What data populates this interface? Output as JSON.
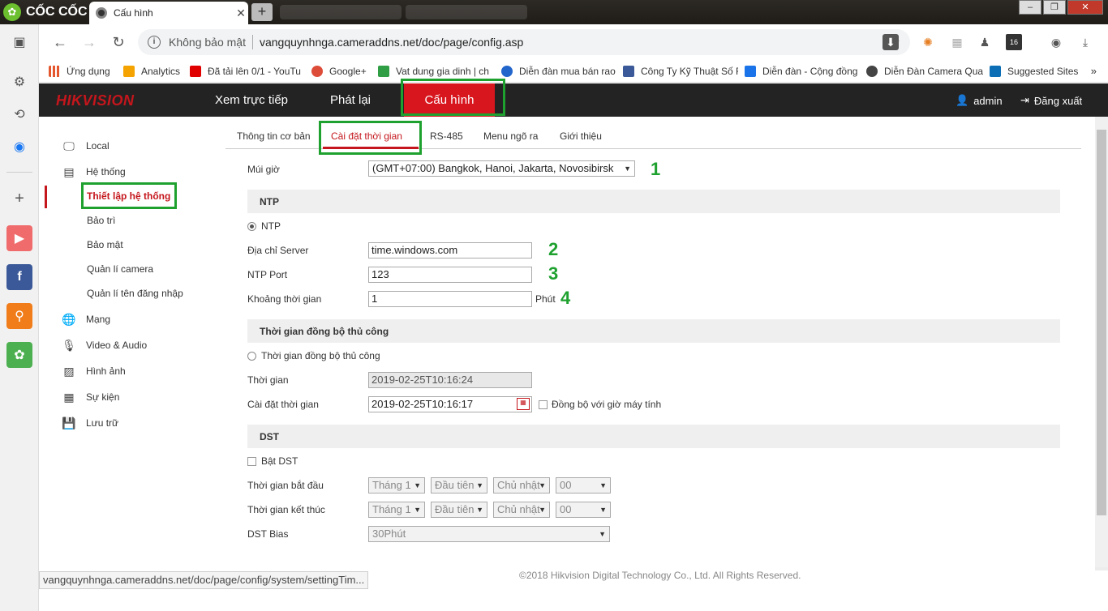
{
  "browser": {
    "brand": "CỐC CỐC",
    "tab_title": "Cấu hình",
    "security": "Không bảo mật",
    "url": "vangquynhnga.cameraddns.net/doc/page/config.asp",
    "status_url": "vangquynhnga.cameraddns.net/doc/page/config/system/settingTim..."
  },
  "bookmarks": [
    {
      "label": "Ứng dụng",
      "color": "#e4572e"
    },
    {
      "label": "Analytics",
      "color": "#f4a300"
    },
    {
      "label": "Đã tải lên 0/1 - YouTu",
      "color": "#e00000"
    },
    {
      "label": "Google+",
      "color": "#dd4b39"
    },
    {
      "label": "Vat dung gia dinh | ch",
      "color": "#2f9e44"
    },
    {
      "label": "Diễn đàn mua bán rao",
      "color": "#2266cc"
    },
    {
      "label": "Công Ty Kỹ Thuật Số F",
      "color": "#3b5998"
    },
    {
      "label": "Diễn đàn - Cộng đồng",
      "color": "#1a73e8"
    },
    {
      "label": "Diễn Đàn Camera Quan",
      "color": "#444444"
    },
    {
      "label": "Suggested Sites",
      "color": "#0c6eb5"
    }
  ],
  "app": {
    "logo": "HIKVISION",
    "nav": [
      "Xem trực tiếp",
      "Phát lại",
      "Cấu hình"
    ],
    "user": "admin",
    "logout": "Đăng xuất"
  },
  "sidebar": {
    "local": "Local",
    "system": "Hệ thống",
    "system_items": [
      "Thiết lập hệ thống",
      "Bảo trì",
      "Bảo mật",
      "Quản lí camera",
      "Quản lí tên đăng nhập"
    ],
    "network": "Mạng",
    "video_audio": "Video & Audio",
    "image": "Hình ảnh",
    "event": "Sự kiện",
    "storage": "Lưu trữ"
  },
  "tabs": [
    "Thông tin cơ bản",
    "Cài đặt thời gian",
    "RS-485",
    "Menu ngõ ra",
    "Giới thiệu"
  ],
  "form": {
    "timezone_label": "Múi giờ",
    "timezone_value": "(GMT+07:00) Bangkok, Hanoi, Jakarta, Novosibirsk",
    "ntp_section": "NTP",
    "ntp_radio": "NTP",
    "server_label": "Địa chỉ Server",
    "server_value": "time.windows.com",
    "port_label": "NTP Port",
    "port_value": "123",
    "interval_label": "Khoảng thời gian",
    "interval_value": "1",
    "interval_unit": "Phút",
    "manual_section": "Thời gian đồng bộ thủ công",
    "manual_radio": "Thời gian đồng bộ thủ công",
    "time_label": "Thời gian",
    "time_value": "2019-02-25T10:16:24",
    "settime_label": "Cài đặt thời gian",
    "settime_value": "2019-02-25T10:16:17",
    "sync_pc": "Đồng bộ với giờ máy tính",
    "dst_section": "DST",
    "dst_enable": "Bật DST",
    "start_label": "Thời gian bắt đầu",
    "end_label": "Thời gian kết thúc",
    "start_month": "Tháng 1",
    "start_week": "Đầu tiên",
    "start_day": "Chủ nhật",
    "start_hour": "00",
    "end_month": "Tháng 1",
    "end_week": "Đầu tiên",
    "end_day": "Chủ nhật",
    "end_hour": "00",
    "bias_label": "DST Bias",
    "bias_value": "30Phút"
  },
  "annotations": [
    "1",
    "2",
    "3",
    "4"
  ],
  "footer": "©2018 Hikvision Digital Technology Co., Ltd. All Rights Reserved.",
  "colors": {
    "accent": "#c4161c",
    "highlight": "#1fa12f",
    "header": "#232323"
  }
}
